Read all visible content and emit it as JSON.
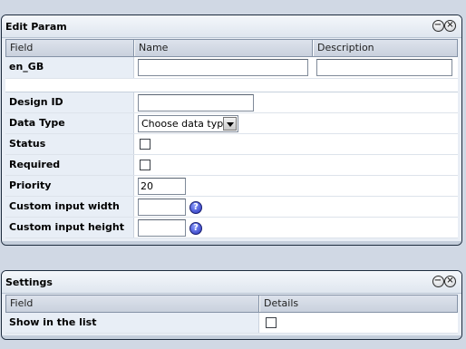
{
  "edit_panel": {
    "title": "Edit Param",
    "min_icon": "−",
    "close_icon": "×",
    "columns": [
      "Field",
      "Name",
      "Description"
    ],
    "locale_row": {
      "label": "en_GB",
      "name_value": "",
      "description_value": ""
    },
    "fields": {
      "design_id": {
        "label": "Design ID",
        "value": ""
      },
      "data_type": {
        "label": "Data Type",
        "selected": "Choose data type"
      },
      "status": {
        "label": "Status",
        "checked": false
      },
      "required": {
        "label": "Required",
        "checked": false
      },
      "priority": {
        "label": "Priority",
        "value": "20"
      },
      "custom_input_width": {
        "label": "Custom input width",
        "value": "",
        "help_icon": "?"
      },
      "custom_input_height": {
        "label": "Custom input height",
        "value": "",
        "help_icon": "?"
      }
    }
  },
  "settings_panel": {
    "title": "Settings",
    "min_icon": "−",
    "close_icon": "×",
    "columns": [
      "Field",
      "Details"
    ],
    "rows": [
      {
        "label": "Show in the list",
        "checked": false
      }
    ]
  }
}
